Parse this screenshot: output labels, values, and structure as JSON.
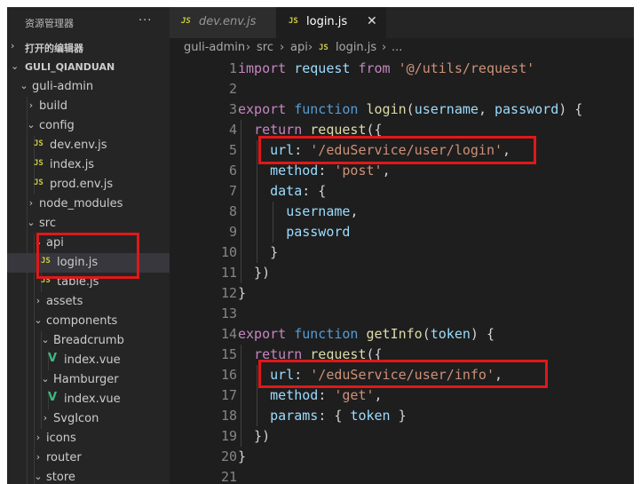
{
  "sidebar": {
    "title": "资源管理器",
    "more": "···",
    "open_editors": {
      "chevron": "›",
      "label": "打开的编辑器"
    },
    "project": {
      "chevron": "⌄",
      "label": "GULI_QIANDUAN"
    },
    "tree": [
      {
        "label": "guli-admin",
        "type": "folder-open"
      },
      {
        "label": "build",
        "type": "folder"
      },
      {
        "label": "config",
        "type": "folder-open"
      },
      {
        "label": "dev.env.js",
        "type": "js"
      },
      {
        "label": "index.js",
        "type": "js"
      },
      {
        "label": "prod.env.js",
        "type": "js"
      },
      {
        "label": "node_modules",
        "type": "folder"
      },
      {
        "label": "src",
        "type": "folder-open"
      },
      {
        "label": "api",
        "type": "folder-open"
      },
      {
        "label": "login.js",
        "type": "js",
        "selected": true
      },
      {
        "label": "table.js",
        "type": "js"
      },
      {
        "label": "assets",
        "type": "folder"
      },
      {
        "label": "components",
        "type": "folder-open"
      },
      {
        "label": "Breadcrumb",
        "type": "folder-open"
      },
      {
        "label": "index.vue",
        "type": "vue"
      },
      {
        "label": "Hamburger",
        "type": "folder-open"
      },
      {
        "label": "index.vue",
        "type": "vue"
      },
      {
        "label": "SvgIcon",
        "type": "folder"
      },
      {
        "label": "icons",
        "type": "folder"
      },
      {
        "label": "router",
        "type": "folder"
      },
      {
        "label": "store",
        "type": "folder-open"
      }
    ]
  },
  "icons": {
    "js": "JS",
    "vue": "V",
    "open": "⌄",
    "closed": "›",
    "close": "✕"
  },
  "tabs": [
    {
      "label": "dev.env.js",
      "active": false
    },
    {
      "label": "login.js",
      "active": true
    }
  ],
  "breadcrumb": {
    "p1": "guli-admin",
    "p2": "src",
    "p3": "api",
    "p4": "login.js",
    "p5": "...",
    "sep": "›"
  },
  "code": [
    {
      "n": "1",
      "tokens": [
        [
          "kw-purple",
          "import"
        ],
        [
          "var",
          " request"
        ],
        [
          "kw-purple",
          " from"
        ],
        [
          "str",
          " '@/utils/request'"
        ]
      ]
    },
    {
      "n": "2",
      "tokens": []
    },
    {
      "n": "3",
      "tokens": [
        [
          "kw-purple",
          "export"
        ],
        [
          "kw-blue",
          " function"
        ],
        [
          "fn",
          " login"
        ],
        [
          "punc",
          "("
        ],
        [
          "var",
          "username"
        ],
        [
          "punc",
          ", "
        ],
        [
          "var",
          "password"
        ],
        [
          "punc",
          ") {"
        ]
      ]
    },
    {
      "n": "4",
      "tokens": [
        [
          "punc",
          "  "
        ],
        [
          "kw-purple",
          "return"
        ],
        [
          "fn",
          " request"
        ],
        [
          "punc",
          "({"
        ]
      ]
    },
    {
      "n": "5",
      "tokens": [
        [
          "punc",
          "    "
        ],
        [
          "var",
          "url"
        ],
        [
          "punc",
          ": "
        ],
        [
          "str",
          "'/eduService/user/login'"
        ],
        [
          "punc",
          ","
        ]
      ]
    },
    {
      "n": "6",
      "tokens": [
        [
          "punc",
          "    "
        ],
        [
          "var",
          "method"
        ],
        [
          "punc",
          ": "
        ],
        [
          "str",
          "'post'"
        ],
        [
          "punc",
          ","
        ]
      ]
    },
    {
      "n": "7",
      "tokens": [
        [
          "punc",
          "    "
        ],
        [
          "var",
          "data"
        ],
        [
          "punc",
          ": {"
        ]
      ]
    },
    {
      "n": "8",
      "tokens": [
        [
          "punc",
          "      "
        ],
        [
          "var",
          "username"
        ],
        [
          "punc",
          ","
        ]
      ]
    },
    {
      "n": "9",
      "tokens": [
        [
          "punc",
          "      "
        ],
        [
          "var",
          "password"
        ]
      ]
    },
    {
      "n": "10",
      "tokens": [
        [
          "punc",
          "    }"
        ]
      ]
    },
    {
      "n": "11",
      "tokens": [
        [
          "punc",
          "  })"
        ]
      ]
    },
    {
      "n": "12",
      "tokens": [
        [
          "punc",
          "}"
        ]
      ]
    },
    {
      "n": "13",
      "tokens": []
    },
    {
      "n": "14",
      "tokens": [
        [
          "kw-purple",
          "export"
        ],
        [
          "kw-blue",
          " function"
        ],
        [
          "fn",
          " getInfo"
        ],
        [
          "punc",
          "("
        ],
        [
          "var",
          "token"
        ],
        [
          "punc",
          ") {"
        ]
      ]
    },
    {
      "n": "15",
      "tokens": [
        [
          "punc",
          "  "
        ],
        [
          "kw-purple",
          "return"
        ],
        [
          "fn",
          " request"
        ],
        [
          "punc",
          "({"
        ]
      ]
    },
    {
      "n": "16",
      "tokens": [
        [
          "punc",
          "    "
        ],
        [
          "var",
          "url"
        ],
        [
          "punc",
          ": "
        ],
        [
          "str",
          "'/eduService/user/info'"
        ],
        [
          "punc",
          ","
        ]
      ]
    },
    {
      "n": "17",
      "tokens": [
        [
          "punc",
          "    "
        ],
        [
          "var",
          "method"
        ],
        [
          "punc",
          ": "
        ],
        [
          "str",
          "'get'"
        ],
        [
          "punc",
          ","
        ]
      ]
    },
    {
      "n": "18",
      "tokens": [
        [
          "punc",
          "    "
        ],
        [
          "var",
          "params"
        ],
        [
          "punc",
          ": { "
        ],
        [
          "var",
          "token"
        ],
        [
          "punc",
          " }"
        ]
      ]
    },
    {
      "n": "19",
      "tokens": [
        [
          "punc",
          "  })"
        ]
      ]
    },
    {
      "n": "20",
      "tokens": [
        [
          "punc",
          "}"
        ]
      ]
    },
    {
      "n": "21",
      "tokens": []
    }
  ],
  "colors": {
    "highlight_box": "#e01818",
    "background": "#1e1e1e",
    "sidebar": "#252526"
  }
}
